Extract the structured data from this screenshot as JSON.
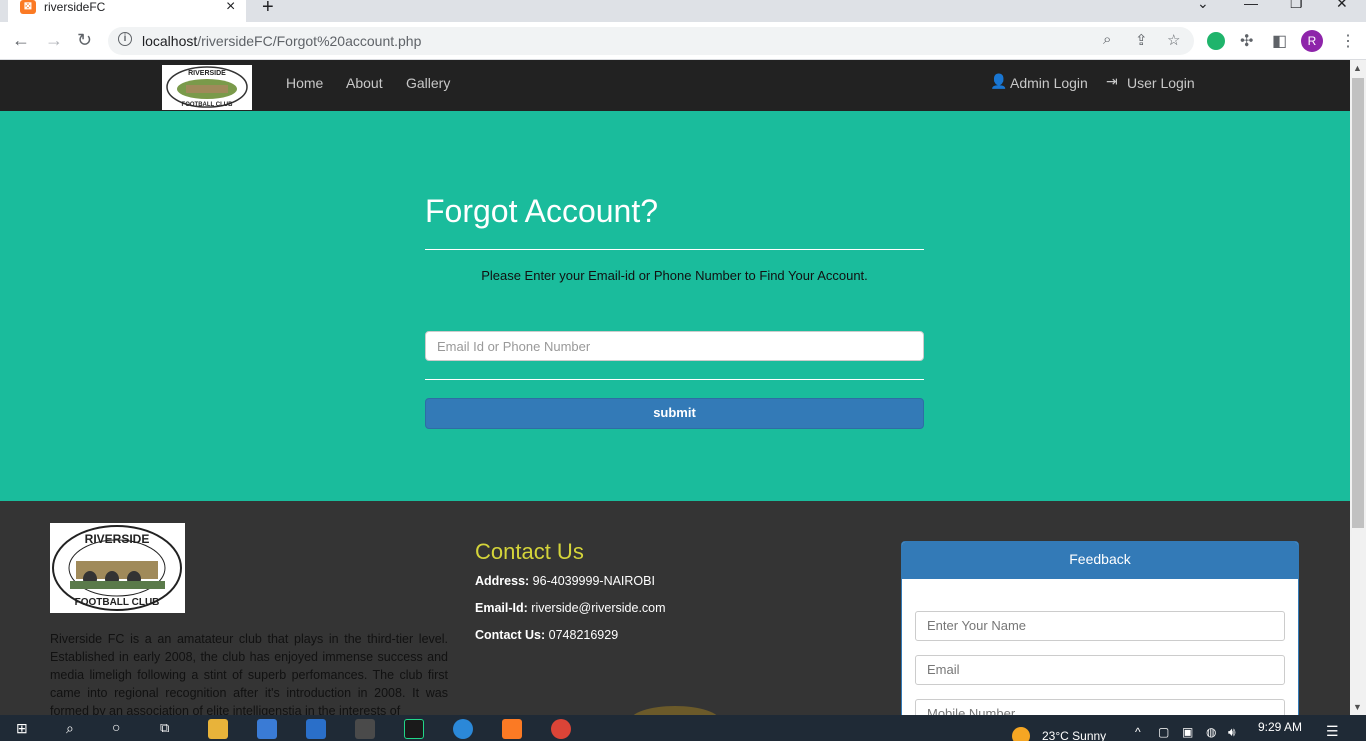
{
  "browser": {
    "tab_title": "riversideFC",
    "url_host": "localhost",
    "url_path": "/riversideFC/Forgot%20account.php",
    "profile_initial": "R"
  },
  "navbar": {
    "links": [
      "Home",
      "About",
      "Gallery"
    ],
    "admin_login": "Admin Login",
    "user_login": "User Login"
  },
  "hero": {
    "title": "Forgot Account?",
    "description": "Please Enter your Email-id or Phone Number to Find Your Account.",
    "input_placeholder": "Email Id or Phone Number",
    "submit_label": "submit"
  },
  "footer": {
    "about": "Riverside FC is a an amatateur club that plays in the third-tier level. Established in early 2008, the club has enjoyed immense success and media limeligh following a stint of superb perfomances. The club first came into regional recognition after it's introduction in 2008. It was formed by an association of elite intelligenstia in the interests of",
    "contact_title": "Contact Us",
    "address_label": "Address:",
    "address_value": "96-4039999-NAIROBI",
    "email_label": "Email-Id:",
    "email_value": "riverside@riverside.com",
    "phone_label": "Contact Us:",
    "phone_value": "0748216929",
    "feedback_title": "Feedback",
    "feedback_name_placeholder": "Enter Your Name",
    "feedback_email_placeholder": "Email",
    "feedback_mobile_placeholder": "Mobile Number"
  },
  "taskbar": {
    "weather": "23°C  Sunny",
    "time": "9:29 AM"
  }
}
